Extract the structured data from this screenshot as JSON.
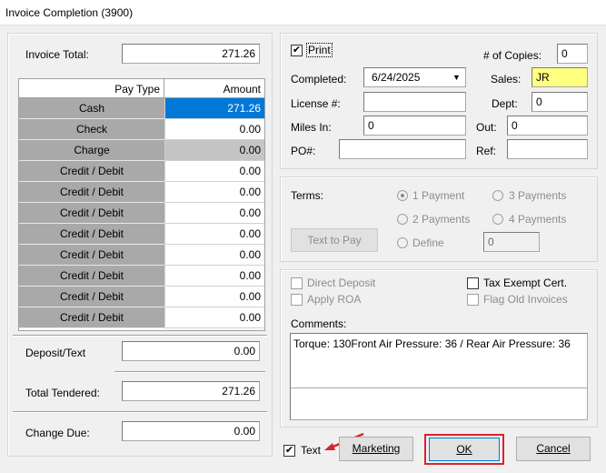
{
  "window": {
    "title": "Invoice Completion (3900)"
  },
  "left": {
    "invoice_total_label": "Invoice Total:",
    "invoice_total_value": "271.26",
    "table_headers": [
      "Pay Type",
      "Amount"
    ],
    "rows": [
      {
        "type": "Cash",
        "amount": "271.26"
      },
      {
        "type": "Check",
        "amount": "0.00"
      },
      {
        "type": "Charge",
        "amount": "0.00"
      },
      {
        "type": "Credit / Debit",
        "amount": "0.00"
      },
      {
        "type": "Credit / Debit",
        "amount": "0.00"
      },
      {
        "type": "Credit / Debit",
        "amount": "0.00"
      },
      {
        "type": "Credit / Debit",
        "amount": "0.00"
      },
      {
        "type": "Credit / Debit",
        "amount": "0.00"
      },
      {
        "type": "Credit / Debit",
        "amount": "0.00"
      },
      {
        "type": "Credit / Debit",
        "amount": "0.00"
      },
      {
        "type": "Credit / Debit",
        "amount": "0.00"
      }
    ],
    "deposit_label": "Deposit/Text",
    "deposit_value": "0.00",
    "total_tendered_label": "Total Tendered:",
    "total_tendered_value": "271.26",
    "change_due_label": "Change Due:",
    "change_due_value": "0.00"
  },
  "top": {
    "print_label": "Print",
    "print_checked": true,
    "copies_label": "# of Copies:",
    "copies_value": "0",
    "completed_label": "Completed:",
    "completed_value": "6/24/2025",
    "sales_label": "Sales:",
    "sales_value": "JR",
    "license_label": "License #:",
    "license_value": "",
    "dept_label": "Dept:",
    "dept_value": "0",
    "miles_in_label": "Miles In:",
    "miles_in_value": "0",
    "out_label": "Out:",
    "out_value": "0",
    "po_label": "PO#:",
    "po_value": "",
    "ref_label": "Ref:",
    "ref_value": ""
  },
  "terms": {
    "label": "Terms:",
    "text_to_pay": "Text to Pay",
    "options": [
      "1 Payment",
      "3 Payments",
      "2 Payments",
      "4 Payments",
      "Define"
    ],
    "define_value": "0"
  },
  "misc": {
    "direct_deposit": "Direct Deposit",
    "apply_roa": "Apply ROA",
    "tax_exempt": "Tax Exempt Cert.",
    "flag_old": "Flag Old Invoices",
    "comments_label": "Comments:",
    "comments_text": "Torque: 130Front Air Pressure: 36 / Rear Air Pressure: 36"
  },
  "bottom": {
    "text_label": "Text",
    "text_checked": true,
    "marketing": "Marketing",
    "ok": "OK",
    "cancel": "Cancel"
  },
  "colors": {
    "selected_amount": "#0078d7",
    "sales_field": "#ffff80",
    "highlight_box": "#d9232f",
    "arrow": "#d9232f"
  }
}
